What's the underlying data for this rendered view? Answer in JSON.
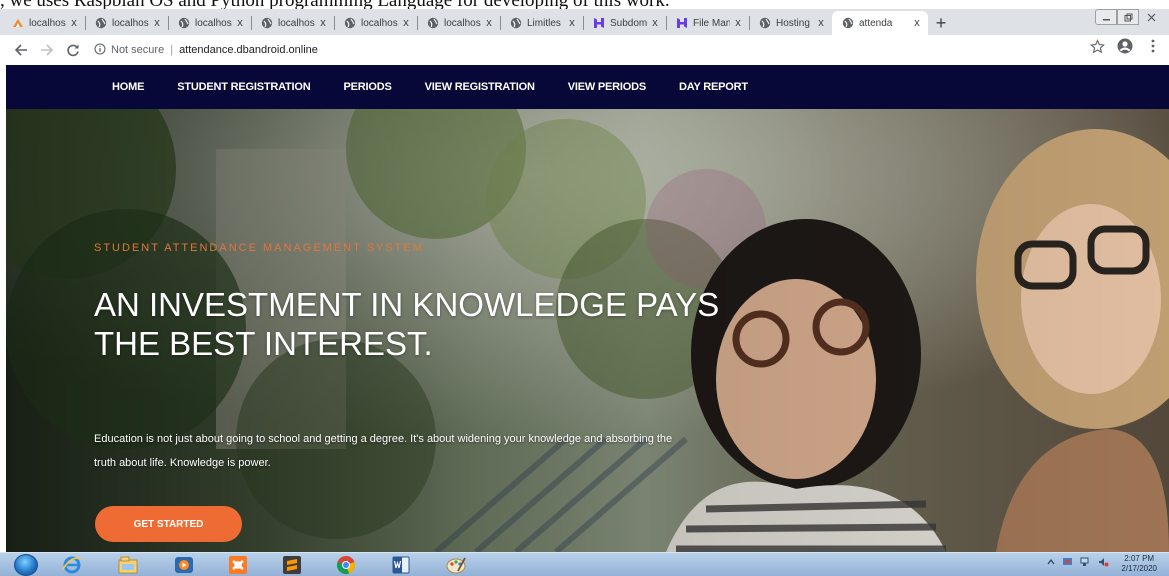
{
  "doc": {
    "line": ", we uses Raspbian OS and Python programming Language for developing of this work."
  },
  "browser": {
    "tabs": [
      {
        "title": "localhos",
        "favicon": "xampp-icon"
      },
      {
        "title": "localhos",
        "favicon": "globe-icon"
      },
      {
        "title": "localhos",
        "favicon": "globe-icon"
      },
      {
        "title": "localhos",
        "favicon": "globe-icon"
      },
      {
        "title": "localhos",
        "favicon": "globe-icon"
      },
      {
        "title": "localhos",
        "favicon": "globe-icon"
      },
      {
        "title": "Limitles",
        "favicon": "globe-icon"
      },
      {
        "title": "Subdom",
        "favicon": "hostinger-icon"
      },
      {
        "title": "File Man",
        "favicon": "hostinger-icon"
      },
      {
        "title": "Hosting",
        "favicon": "globe-icon"
      },
      {
        "title": "attenda",
        "favicon": "globe-icon",
        "active": true
      }
    ],
    "new_tab": "+",
    "close_glyph": "x",
    "address": {
      "security_label": "Not secure",
      "url": "attendance.dbandroid.online"
    }
  },
  "site": {
    "nav": [
      "HOME",
      "STUDENT REGISTRATION",
      "PERIODS",
      "VIEW REGISTRATION",
      "VIEW PERIODS",
      "DAY REPORT"
    ],
    "hero": {
      "kicker": "STUDENT ATTENDANCE MANAGEMENT SYSTEM",
      "title": "AN INVESTMENT IN KNOWLEDGE PAYS THE BEST INTEREST.",
      "text": "Education is not just about going to school and getting a degree. It's about widening your knowledge and absorbing the truth about life. Knowledge is power.",
      "cta": "GET STARTED"
    },
    "colors": {
      "nav_bg": "#080838",
      "accent": "#ee6c33",
      "kicker": "#e2763a"
    }
  },
  "taskbar": {
    "apps": [
      "ie-icon",
      "explorer-icon",
      "media-player-icon",
      "xampp-icon",
      "sublime-icon",
      "chrome-icon",
      "word-icon",
      "paint-icon"
    ],
    "time": "2:07 PM",
    "date": "2/17/2020"
  }
}
